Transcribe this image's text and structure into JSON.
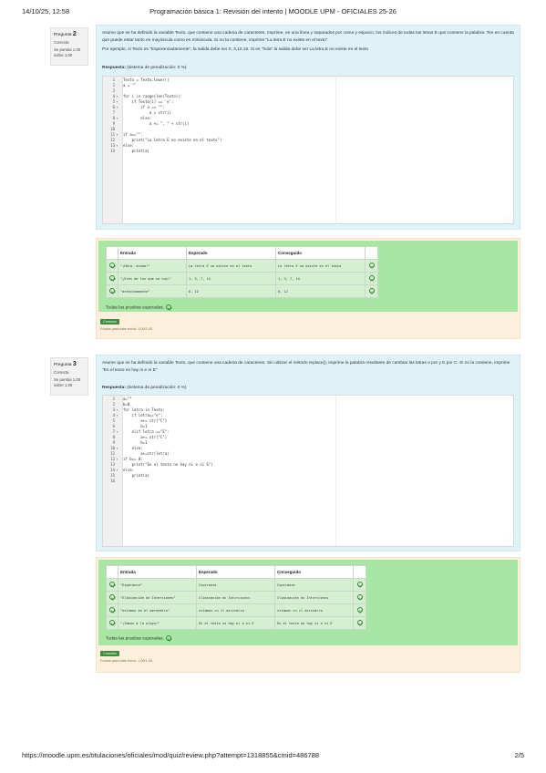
{
  "print_header": {
    "date": "14/10/25, 12:58",
    "title": "Programación básica 1: Revisión del intento | MOODLE UPM - OFICIALES 25-26"
  },
  "print_footer": {
    "url": "https://moodle.upm.es/titulaciones/oficiales/mod/quiz/review.php?attempt=1318855&cmid=486788",
    "page": "2/5"
  },
  "questions": [
    {
      "label": "Pregunta",
      "number": "2",
      "state": "Correcta",
      "grade_line1": "Se puntúa 1,00",
      "grade_line2": "sobre 1,00",
      "text_p1": "Asume que se ha definido la variable Texto, que contiene una cadena de caracteres. Imprime, en una línea y separados por coma y espacio, los índices de todas las letras E que contiene la palabra. Ten en cuenta que puede estar tanto en mayúscula como en minúscula. Si no la contiene, imprime \"La letra E no existe en el texto\".",
      "text_p2": "Por ejemplo, si Texto es \"Esperanzadamente\", la salida debe ser 0, 3,12,15. Si es \"hola\" la salida debe ser La letra E no existe en el texto",
      "answer_label": "Respuesta:",
      "penalty": "(sistema de penalización: 0 %)",
      "code": [
        {
          "n": "1",
          "fold": "",
          "text": "Texto = Texto.lower()"
        },
        {
          "n": "2",
          "fold": "",
          "text": "a = \"\""
        },
        {
          "n": "3",
          "fold": "",
          "text": ""
        },
        {
          "n": "4",
          "fold": "▾",
          "text": "for i in range(len(Texto)):"
        },
        {
          "n": "5",
          "fold": "▾",
          "text": "    if Texto[i] == 'e':"
        },
        {
          "n": "6",
          "fold": "▾",
          "text": "        if a == \"\":"
        },
        {
          "n": "7",
          "fold": "",
          "text": "            a = str(i)"
        },
        {
          "n": "8",
          "fold": "▾",
          "text": "        else:"
        },
        {
          "n": "9",
          "fold": "",
          "text": "            a += \", \" + str(i)"
        },
        {
          "n": "10",
          "fold": "",
          "text": ""
        },
        {
          "n": "11",
          "fold": "▾",
          "text": "if a==\"\":"
        },
        {
          "n": "12",
          "fold": "",
          "text": "    print(\"La letra E no existe en el texto\")"
        },
        {
          "n": "13",
          "fold": "▾",
          "text": "else:"
        },
        {
          "n": "14",
          "fold": "",
          "text": "    print(a)"
        }
      ],
      "results": {
        "headers": [
          "",
          "Entrada",
          "Esperado",
          "Conseguido",
          ""
        ],
        "rows": [
          {
            "entrada": "\"¡Hola, mundo!\"",
            "esperado": "La letra E no existe en el texto",
            "conseguido": "La letra E no existe en el texto"
          },
          {
            "entrada": "\"¿Eres de los que no hay!\"",
            "esperado": "1, 3, 7, 14",
            "conseguido": "1, 3, 7, 14"
          },
          {
            "entrada": "\"anteitoamente\"",
            "esperado": "6, 12",
            "conseguido": "6, 12"
          }
        ],
        "all_passed": "Todas las pruebas superadas.",
        "badge": "Correcta",
        "grade_note": "Puntos para este envío: 1,00/1,00."
      }
    },
    {
      "label": "Pregunta",
      "number": "3",
      "state": "Correcta",
      "grade_line1": "Se puntúa 1,00",
      "grade_line2": "sobre 1,00",
      "text_p1": "Asume que se ha definido la variable Texto, que contiene una cadena de caracteres. Sin utilizar el método replace(), imprime la palabra resultante de cambiar las letras e por y E por C. Si no la contiene, imprime \"En el texto no hay ni e ni E\"",
      "text_p2": "",
      "answer_label": "Respuesta:",
      "penalty": "(sistema de penalización: 0 %)",
      "code": [
        {
          "n": "1",
          "fold": "",
          "text": "a=\"\""
        },
        {
          "n": "2",
          "fold": "",
          "text": "b=0"
        },
        {
          "n": "3",
          "fold": "▾",
          "text": "for letra in Texto:"
        },
        {
          "n": "4",
          "fold": "▾",
          "text": "    if letra==\"e\":"
        },
        {
          "n": "5",
          "fold": "",
          "text": "        a+= str(\"C\")"
        },
        {
          "n": "6",
          "fold": "",
          "text": "        b=1"
        },
        {
          "n": "7",
          "fold": "▾",
          "text": "    elif letra ==\"E\":"
        },
        {
          "n": "8",
          "fold": "",
          "text": "        a+= str(\"C\")"
        },
        {
          "n": "9",
          "fold": "",
          "text": "        b=1"
        },
        {
          "n": "10",
          "fold": "▾",
          "text": "    else:"
        },
        {
          "n": "11",
          "fold": "",
          "text": "        a+=str(letra)"
        },
        {
          "n": "12",
          "fold": "▾",
          "text": "if b== 0:"
        },
        {
          "n": "13",
          "fold": "",
          "text": "    print(\"En el texto no hay ni e ni E\")"
        },
        {
          "n": "14",
          "fold": "▾",
          "text": "else:"
        },
        {
          "n": "15",
          "fold": "",
          "text": "    print(a)"
        },
        {
          "n": "16",
          "fold": "",
          "text": ""
        }
      ],
      "results": {
        "headers": [
          "",
          "Entrada",
          "Esperado",
          "Conseguido",
          ""
        ],
        "rows": [
          {
            "entrada": "\"Esperanza\"",
            "esperado": "Cspcranza",
            "conseguido": "Cspcranza"
          },
          {
            "entrada": "\"Eliminación de Interciones\"",
            "esperado": "Climinación dc Intcrcioncs",
            "conseguido": "Climinación dc Intcrcioncs"
          },
          {
            "entrada": "\"estamos en el merendero\"",
            "esperado": "cstamos cn cl mcrcndcro",
            "conseguido": "cstamos cn cl mcrcndcro"
          },
          {
            "entrada": "\"¡Vamos a la playa!\"",
            "esperado": "En el texto no hay ni e ni E",
            "conseguido": "En el texto no hay ni e ni E"
          }
        ],
        "all_passed": "Todas las pruebas superadas.",
        "badge": "Correcta",
        "grade_note": "Puntos para este envío: 1,00/1,00."
      }
    }
  ],
  "colors": {
    "question_bg": "#def2f8",
    "feedback_bg": "#fcefdc",
    "results_green": "#a8e6a3",
    "badge_green": "#3d8b3d"
  }
}
